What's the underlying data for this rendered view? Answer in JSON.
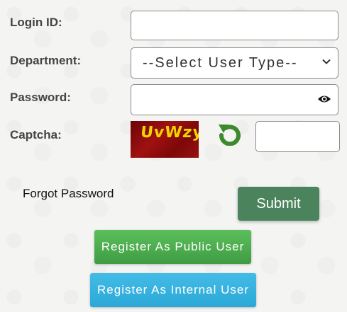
{
  "form": {
    "login_id_label": "Login ID:",
    "login_id_value": "",
    "department_label": "Department:",
    "department_selected": "--Select User Type--",
    "password_label": "Password:",
    "password_value": "",
    "captcha_label": "Captcha:",
    "captcha_image_text": "UvWzyV",
    "captcha_value": "",
    "forgot_password": "Forgot Password",
    "submit_label": "Submit",
    "register_public_label": "Register As Public User",
    "register_internal_label": "Register As Internal User"
  },
  "icons": {
    "password_toggle": "eye-icon",
    "department_dropdown": "chevron-down-icon",
    "captcha_refresh": "refresh-icon"
  },
  "colors": {
    "submit": "#4b845c",
    "register_public": "#4caf50",
    "register_internal": "#35b2e0",
    "refresh_icon": "#3c8a2c",
    "captcha_text": "#f1d400",
    "captcha_bg": "#8b0d0d"
  }
}
